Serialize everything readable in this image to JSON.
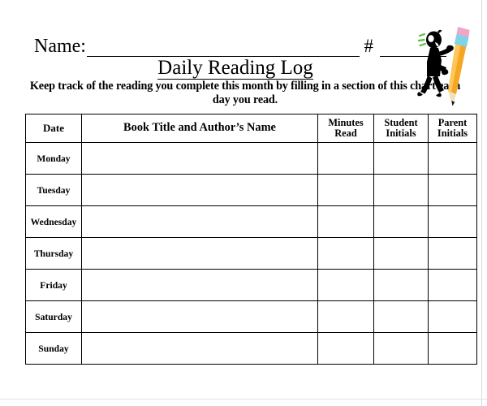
{
  "document": {
    "name_label": "Name:",
    "hash_label": "#",
    "title": "Daily Reading Log",
    "instructions": "Keep track of the reading you complete this month by filling in a section of this chart each day you read.",
    "name_value": "",
    "hash_value": ""
  },
  "table": {
    "columns": [
      {
        "key": "date",
        "label": "Date"
      },
      {
        "key": "book",
        "label": "Book Title and Author’s Name"
      },
      {
        "key": "minutes",
        "label": "Minutes Read"
      },
      {
        "key": "student",
        "label": "Student Initials"
      },
      {
        "key": "parent",
        "label": "Parent Initials"
      }
    ],
    "column_labels_wrapped": {
      "minutes_line1": "Minutes",
      "minutes_line2": "Read",
      "student_line1": "Student",
      "student_line2": "Initials",
      "parent_line1": "Parent",
      "parent_line2": "Initials"
    },
    "rows": [
      {
        "day": "Monday",
        "book": "",
        "minutes": "",
        "student": "",
        "parent": ""
      },
      {
        "day": "Tuesday",
        "book": "",
        "minutes": "",
        "student": "",
        "parent": ""
      },
      {
        "day": "Wednesday",
        "book": "",
        "minutes": "",
        "student": "",
        "parent": ""
      },
      {
        "day": "Thursday",
        "book": "",
        "minutes": "",
        "student": "",
        "parent": ""
      },
      {
        "day": "Friday",
        "book": "",
        "minutes": "",
        "student": "",
        "parent": ""
      },
      {
        "day": "Saturday",
        "book": "",
        "minutes": "",
        "student": "",
        "parent": ""
      },
      {
        "day": "Sunday",
        "book": "",
        "minutes": "",
        "student": "",
        "parent": ""
      }
    ]
  },
  "illustration": {
    "name": "stick-figure-with-pencil",
    "colors": {
      "figure": "#000000",
      "pencil_body": "#f5a623",
      "pencil_body_light": "#ffc65c",
      "pencil_eraser": "#efa6c8",
      "pencil_ferrule": "#7fd4e8",
      "pencil_tip": "#f0dcb4",
      "pencil_lead": "#1a1a1a",
      "motion_lines": "#4caf50"
    }
  },
  "colors": {
    "page_background": "#ffffff",
    "ink": "#000000",
    "page_edge": "#d8d8d8"
  }
}
